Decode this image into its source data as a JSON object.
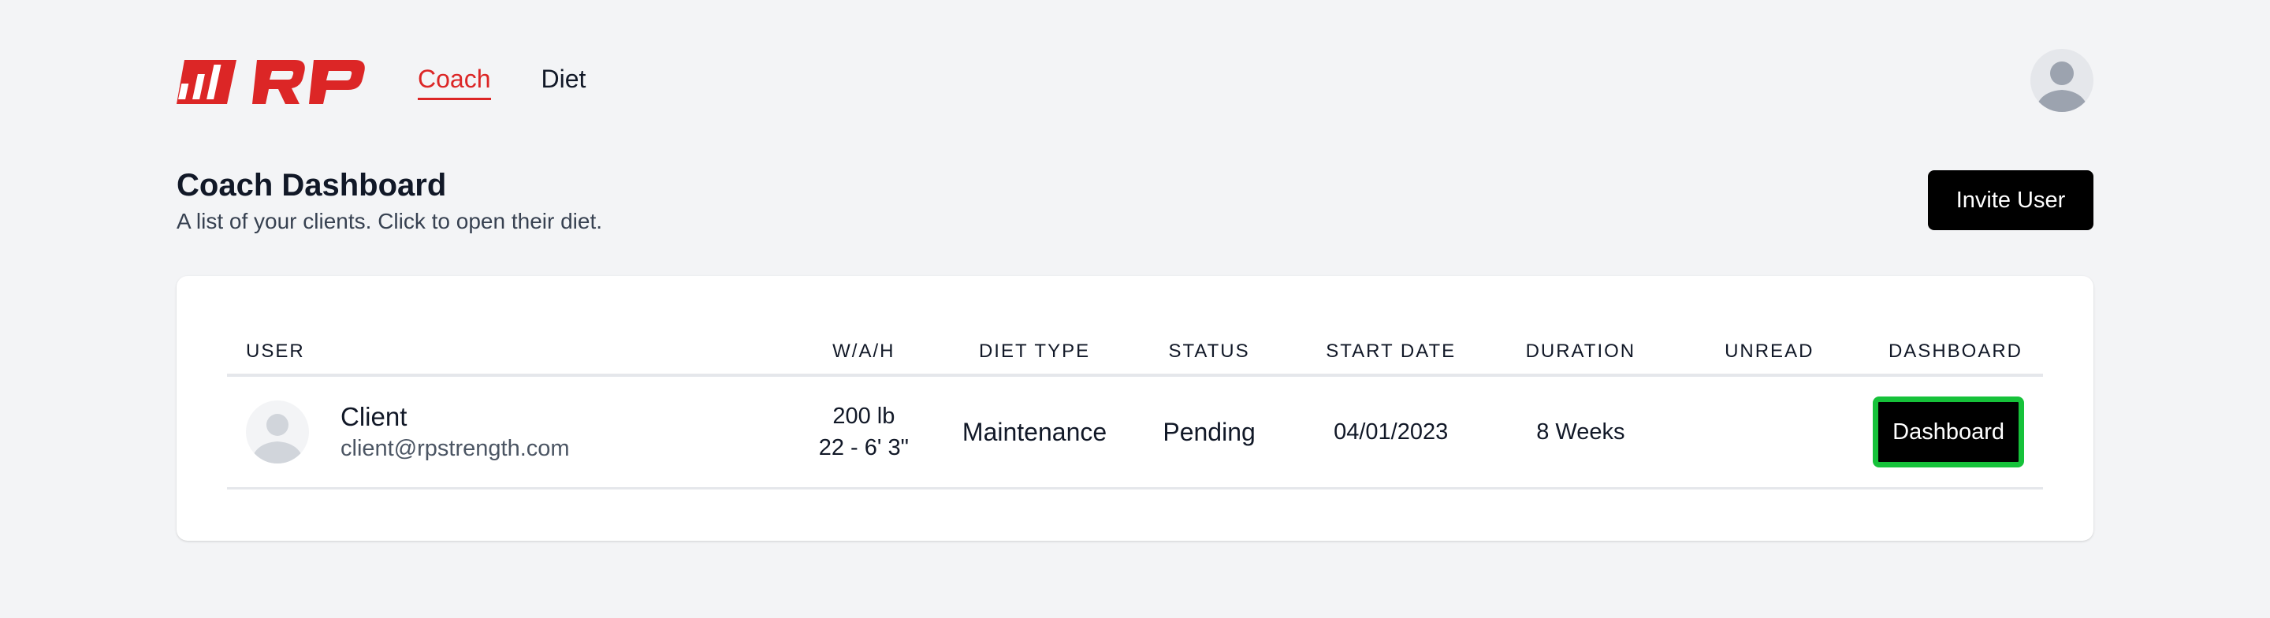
{
  "colors": {
    "brand_red": "#dc2626",
    "background": "#f3f4f6",
    "button_black": "#000000",
    "highlight_green": "#16c23a"
  },
  "header": {
    "logo_icon": "rp-logo-icon",
    "nav": [
      {
        "label": "Coach",
        "active": true
      },
      {
        "label": "Diet",
        "active": false
      }
    ],
    "avatar_icon": "user-avatar-icon"
  },
  "page": {
    "title": "Coach Dashboard",
    "subtitle": "A list of your clients. Click to open their diet.",
    "invite_button": "Invite User"
  },
  "table": {
    "columns": [
      "USER",
      "W/A/H",
      "DIET TYPE",
      "STATUS",
      "START DATE",
      "DURATION",
      "UNREAD",
      "DASHBOARD"
    ],
    "rows": [
      {
        "name": "Client",
        "email": "client@rpstrength.com",
        "weight": "200 lb",
        "age_height": "22 - 6' 3\"",
        "diet_type": "Maintenance",
        "status": "Pending",
        "start_date": "04/01/2023",
        "duration": "8 Weeks",
        "unread": "",
        "dashboard_button": "Dashboard"
      }
    ]
  }
}
